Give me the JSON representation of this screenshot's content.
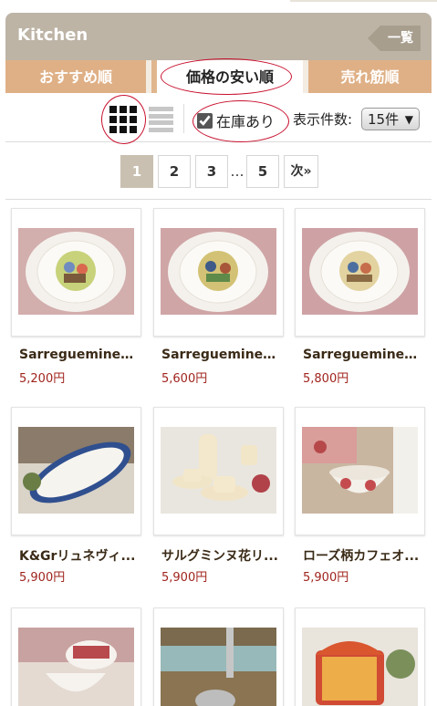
{
  "header": {
    "title": "Kitchen",
    "list_all": "一覧"
  },
  "tabs": [
    {
      "label": "おすすめ順"
    },
    {
      "label": "価格の安い順"
    },
    {
      "label": "売れ筋順"
    }
  ],
  "toolbar": {
    "in_stock_label": "在庫あり",
    "in_stock_checked": true,
    "count_label": "表示件数:",
    "count_value": "15件",
    "count_arrow": "▼"
  },
  "pagination": {
    "pages": [
      "1",
      "2",
      "3",
      "5"
    ],
    "ellipsis": "…",
    "next": "次»"
  },
  "products": [
    {
      "name": "Sarreguemines...",
      "price": "5,200円"
    },
    {
      "name": "Sarreguemines...",
      "price": "5,600円"
    },
    {
      "name": "Sarreguemines...",
      "price": "5,800円"
    },
    {
      "name": "K&Grリュネヴィ...",
      "price": "5,900円"
    },
    {
      "name": "サルグミンヌ花リ...",
      "price": "5,900円"
    },
    {
      "name": "ローズ柄カフェオ...",
      "price": "5,900円"
    },
    {
      "name": "",
      "price": ""
    },
    {
      "name": "",
      "price": ""
    },
    {
      "name": "",
      "price": ""
    }
  ],
  "colors": {
    "header_bg": "#bdb4a6",
    "tab_bg": "#dfb086",
    "price": "#a0241e",
    "annotation_oval": "#c8102e"
  }
}
